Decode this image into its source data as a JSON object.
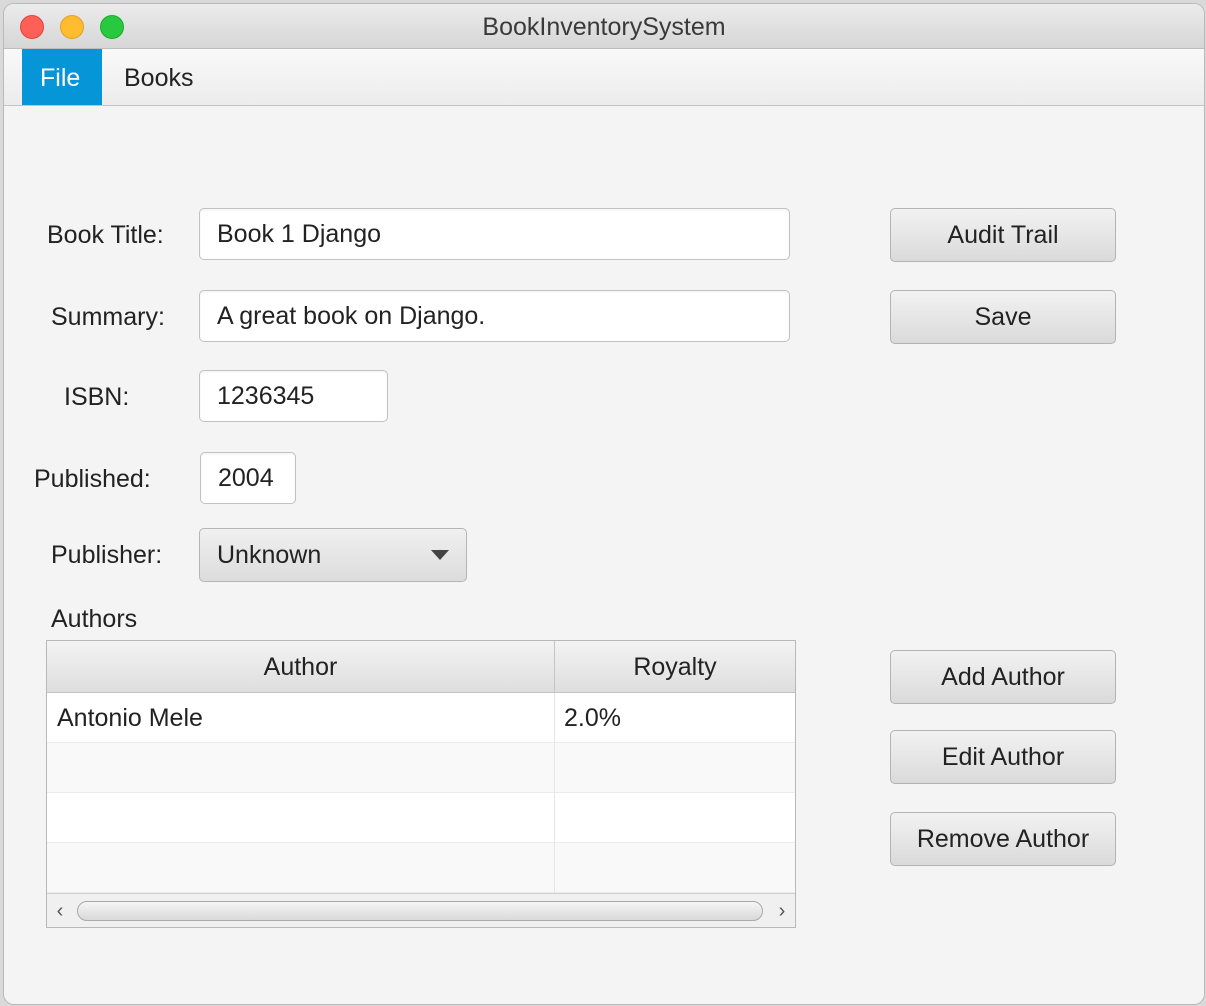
{
  "window": {
    "title": "BookInventorySystem"
  },
  "menu": {
    "file": "File",
    "books": "Books"
  },
  "form": {
    "title_label": "Book Title:",
    "title_value": "Book 1 Django",
    "summary_label": "Summary:",
    "summary_value": "A great book on Django.",
    "isbn_label": "ISBN:",
    "isbn_value": "1236345",
    "published_label": "Published:",
    "published_value": "2004",
    "publisher_label": "Publisher:",
    "publisher_selected": "Unknown"
  },
  "authors": {
    "section_label": "Authors",
    "columns": [
      "Author",
      "Royalty"
    ],
    "rows": [
      {
        "author": "Antonio Mele",
        "royalty": "2.0%"
      }
    ]
  },
  "buttons": {
    "audit_trail": "Audit Trail",
    "save": "Save",
    "add_author": "Add Author",
    "edit_author": "Edit Author",
    "remove_author": "Remove Author"
  },
  "icons": {
    "close": "close-icon",
    "minimize": "minimize-icon",
    "maximize": "maximize-icon",
    "dropdown": "chevron-down-icon",
    "scroll_left": "scroll-left-icon",
    "scroll_right": "scroll-right-icon"
  },
  "colors": {
    "menu_active": "#0696d7",
    "close": "#fe5f57",
    "minimize": "#febc2e",
    "maximize": "#28c840"
  }
}
